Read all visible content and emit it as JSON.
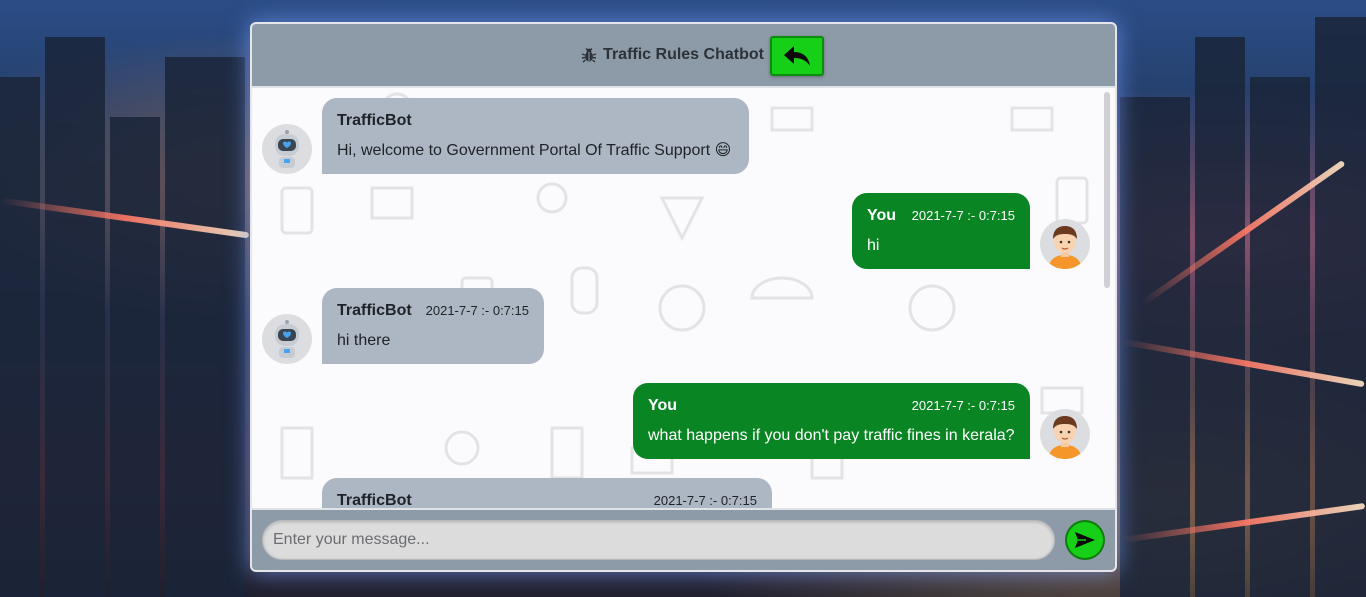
{
  "header": {
    "title": "Traffic Rules Chatbot",
    "left_icon": "bug-icon",
    "right_icon": "bug-icon",
    "back_icon": "reply-arrow-icon"
  },
  "messages": [
    {
      "side": "left",
      "name": "TrafficBot",
      "time": "",
      "text": "Hi, welcome to Government Portal Of Traffic Support 😄",
      "avatar": "robot-avatar"
    },
    {
      "side": "right",
      "name": "You",
      "time": "2021-7-7 :- 0:7:15",
      "text": "hi",
      "avatar": "user-avatar"
    },
    {
      "side": "left",
      "name": "TrafficBot",
      "time": "2021-7-7 :- 0:7:15",
      "text": "hi there",
      "avatar": "robot-avatar"
    },
    {
      "side": "right",
      "name": "You",
      "time": "2021-7-7 :- 0:7:15",
      "text": "what happens if you don't pay traffic fines in kerala?",
      "avatar": "user-avatar"
    },
    {
      "side": "left",
      "name": "TrafficBot",
      "time": "2021-7-7 :- 0:7:15",
      "text": "",
      "avatar": "robot-avatar"
    }
  ],
  "composer": {
    "placeholder": "Enter your message...",
    "value": "",
    "send_icon": "send-arrow-icon"
  },
  "colors": {
    "header_bg": "#8d9aa7",
    "bot_bubble": "#adb6c3",
    "user_bubble": "#0a8523",
    "accent_green": "#15d016"
  }
}
